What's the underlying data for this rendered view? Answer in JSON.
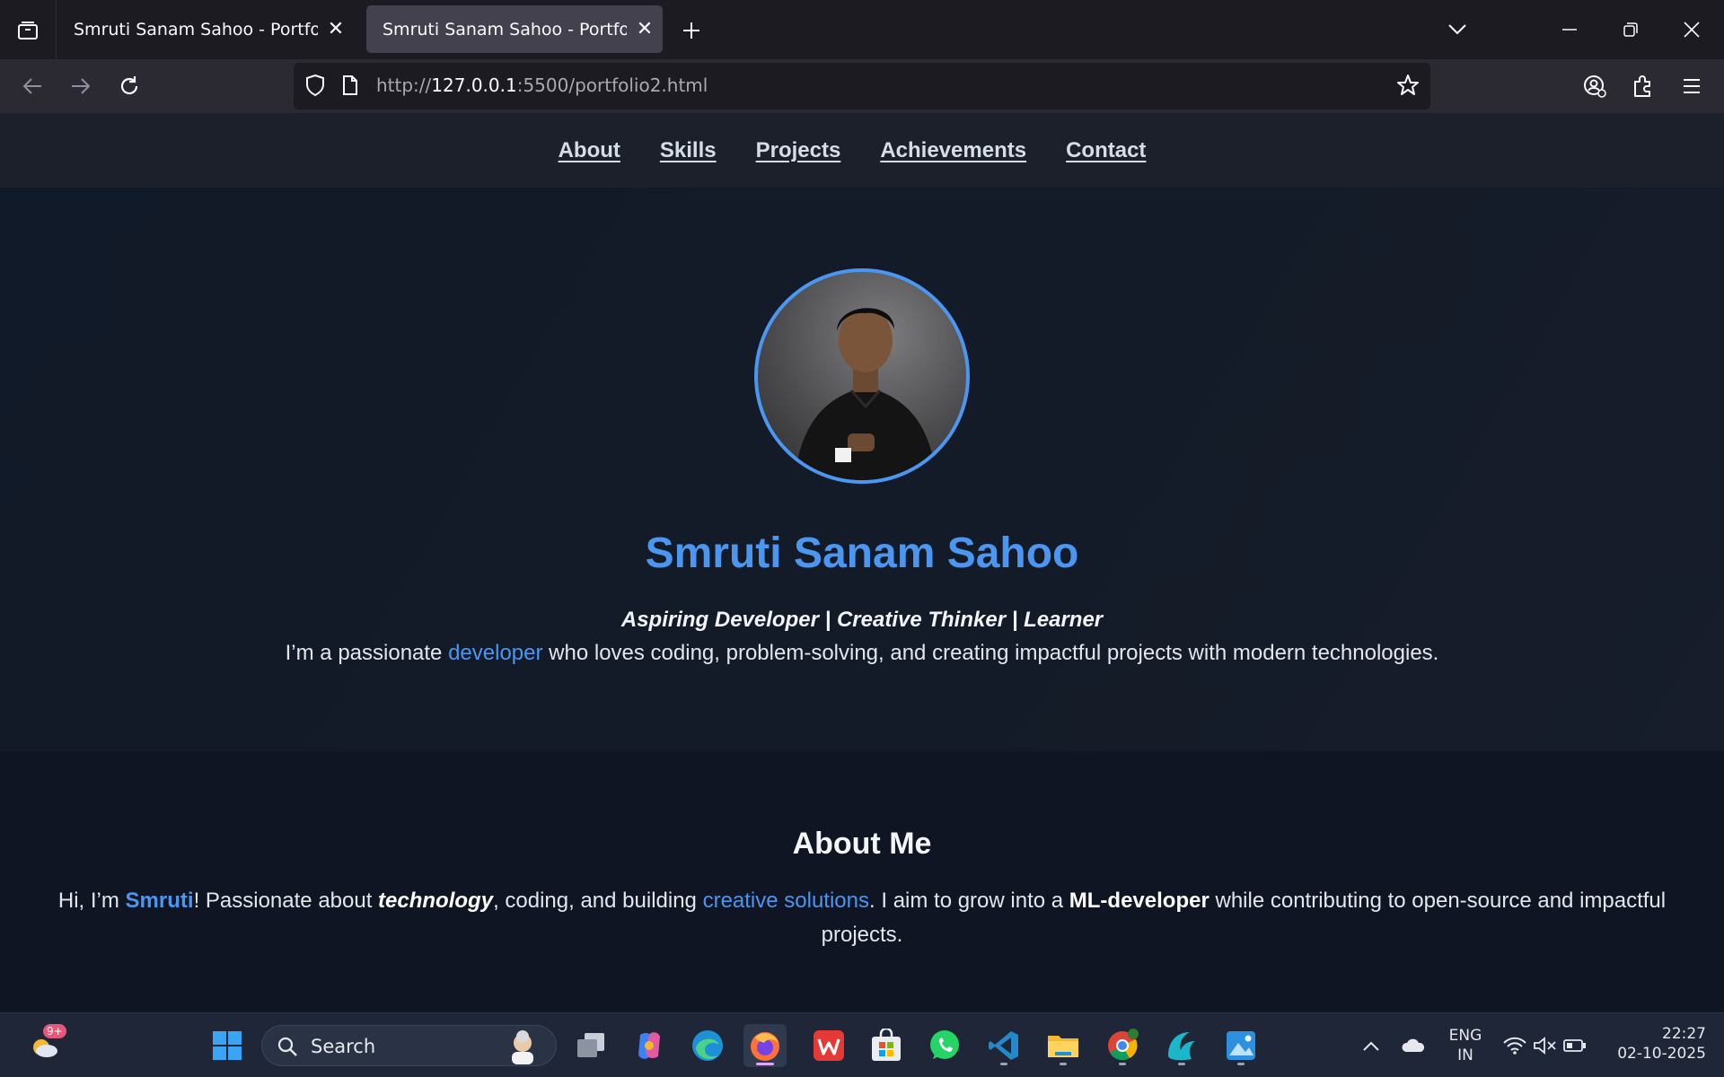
{
  "browser": {
    "tabs": [
      {
        "title": "Smruti Sanam Sahoo - Portfolio",
        "active": false
      },
      {
        "title": "Smruti Sanam Sahoo - Portfolio",
        "active": true
      }
    ],
    "url": {
      "prefix": "http://",
      "host": "127.0.0.1",
      "rest": ":5500/portfolio2.html"
    }
  },
  "site": {
    "nav": [
      "About",
      "Skills",
      "Projects",
      "Achievements",
      "Contact"
    ],
    "hero": {
      "name": "Smruti Sanam Sahoo",
      "tagline": "Aspiring Developer | Creative Thinker | Learner",
      "desc_before": "I’m a passionate ",
      "desc_highlight": "developer",
      "desc_after": " who loves coding, problem-solving, and creating impactful projects with modern technologies."
    },
    "about": {
      "title": "About Me",
      "p1": "Hi, I’m ",
      "name": "Smruti",
      "p2": "! Passionate about ",
      "tech": "technology",
      "p3": ", coding, and building ",
      "creative": "creative solutions",
      "p4": ". I aim to grow into a ",
      "role": "ML-developer",
      "p5": " while contributing to open-source and impactful projects."
    }
  },
  "taskbar": {
    "weather_badge": "9+",
    "search_label": "Search",
    "lang": "ENG",
    "region": "IN",
    "time": "22:27",
    "date": "02-10-2025"
  },
  "colors": {
    "accent": "#4a96f0",
    "page_bg": "#0f1624",
    "nav_bg": "#1b202b"
  }
}
